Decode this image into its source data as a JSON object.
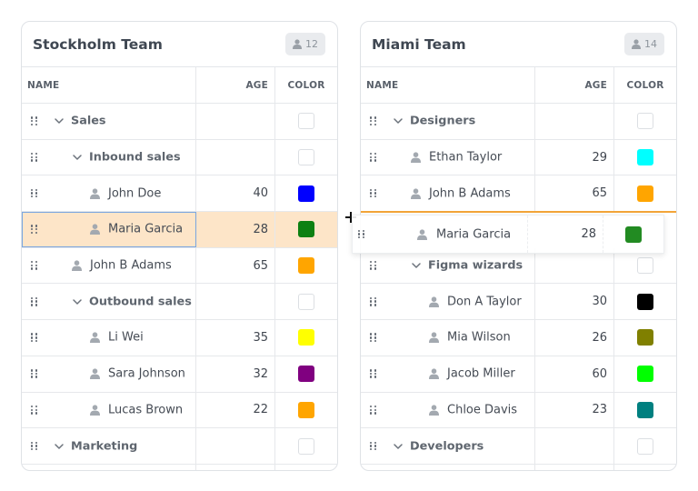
{
  "columns": {
    "name": "NAME",
    "age": "AGE",
    "color": "COLOR"
  },
  "left": {
    "title": "Stockholm Team",
    "count": "12",
    "rows": [
      {
        "kind": "group",
        "level": 0,
        "label": "Sales"
      },
      {
        "kind": "group",
        "level": 1,
        "label": "Inbound sales"
      },
      {
        "kind": "person",
        "level": 2,
        "name": "John Doe",
        "age": "40",
        "color": "#0000ff"
      },
      {
        "kind": "person",
        "level": 2,
        "name": "Maria Garcia",
        "age": "28",
        "color": "#0d8012",
        "selected": true
      },
      {
        "kind": "person",
        "level": 1,
        "name": "John B Adams",
        "age": "65",
        "color": "#ffa500"
      },
      {
        "kind": "group",
        "level": 1,
        "label": "Outbound sales"
      },
      {
        "kind": "person",
        "level": 2,
        "name": "Li Wei",
        "age": "35",
        "color": "#ffff00"
      },
      {
        "kind": "person",
        "level": 2,
        "name": "Sara Johnson",
        "age": "32",
        "color": "#800080"
      },
      {
        "kind": "person",
        "level": 2,
        "name": "Lucas Brown",
        "age": "22",
        "color": "#ffa500"
      },
      {
        "kind": "group",
        "level": 0,
        "label": "Marketing"
      }
    ]
  },
  "right": {
    "title": "Miami Team",
    "count": "14",
    "rows": [
      {
        "kind": "group",
        "level": 0,
        "label": "Designers"
      },
      {
        "kind": "person",
        "level": 1,
        "name": "Ethan Taylor",
        "age": "29",
        "color": "#00ffff"
      },
      {
        "kind": "person",
        "level": 1,
        "name": "John B Adams",
        "age": "65",
        "color": "#ffa500"
      },
      {
        "kind": "placeholder"
      },
      {
        "kind": "group",
        "level": 1,
        "label": "Figma wizards"
      },
      {
        "kind": "person",
        "level": 2,
        "name": "Don A Taylor",
        "age": "30",
        "color": "#000000"
      },
      {
        "kind": "person",
        "level": 2,
        "name": "Mia Wilson",
        "age": "26",
        "color": "#808000"
      },
      {
        "kind": "person",
        "level": 2,
        "name": "Jacob Miller",
        "age": "60",
        "color": "#00ff00"
      },
      {
        "kind": "person",
        "level": 2,
        "name": "Chloe Davis",
        "age": "23",
        "color": "#008080"
      },
      {
        "kind": "group",
        "level": 0,
        "label": "Developers"
      }
    ]
  },
  "drag_ghost": {
    "name": "Maria Garcia",
    "age": "28",
    "color": "#228b22"
  }
}
